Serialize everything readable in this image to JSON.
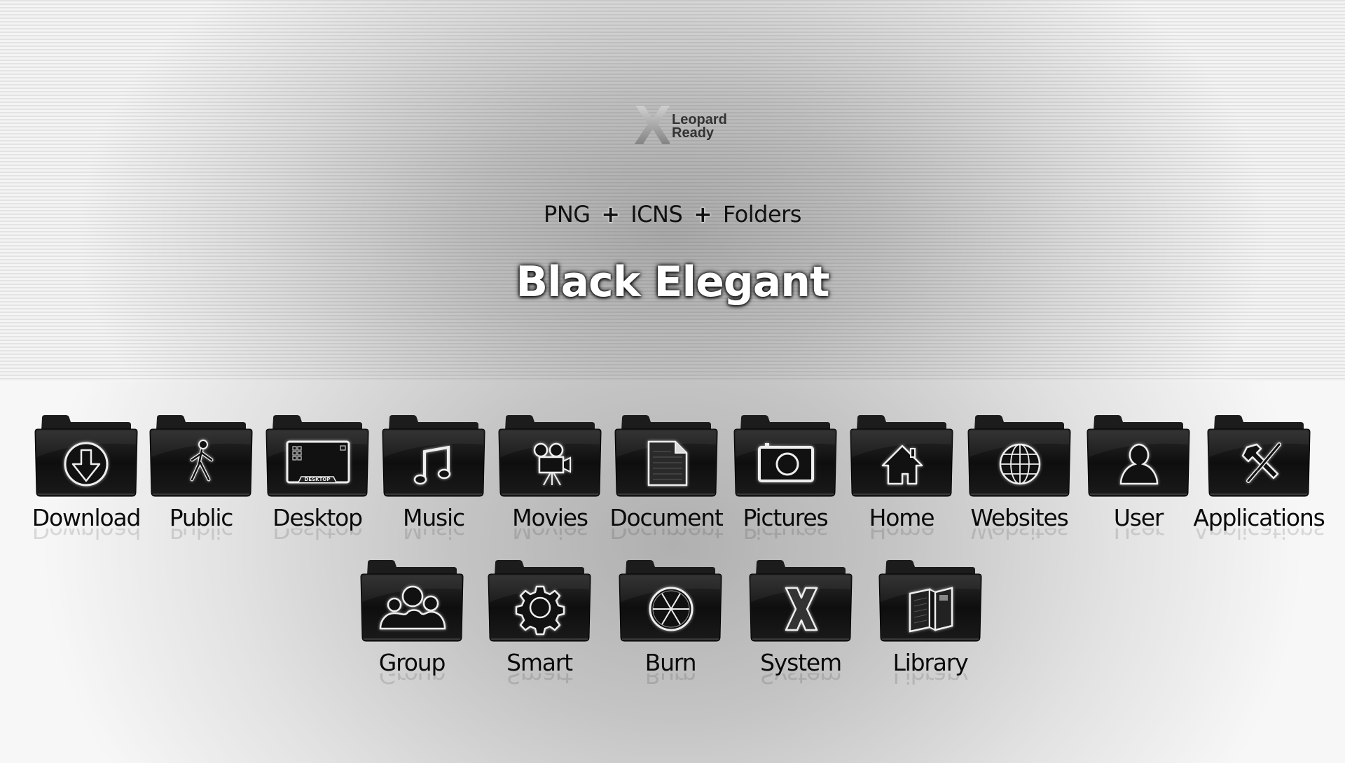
{
  "header": {
    "logo": {
      "mark": "X",
      "line1": "Leopard",
      "line2": "Ready"
    },
    "subtitle": {
      "parts": [
        "PNG",
        "ICNS",
        "Folders"
      ],
      "separator": "+"
    },
    "title": "Black Elegant"
  },
  "icons": {
    "row1": [
      {
        "label": "Download",
        "icon": "download-arrow-icon"
      },
      {
        "label": "Public",
        "icon": "walking-person-icon"
      },
      {
        "label": "Desktop",
        "icon": "desktop-screen-icon",
        "inner_text": "DESKTOP"
      },
      {
        "label": "Music",
        "icon": "music-note-icon"
      },
      {
        "label": "Movies",
        "icon": "movie-camera-icon"
      },
      {
        "label": "Document",
        "icon": "document-page-icon"
      },
      {
        "label": "Pictures",
        "icon": "camera-icon"
      },
      {
        "label": "Home",
        "icon": "house-icon"
      },
      {
        "label": "Websites",
        "icon": "globe-icon"
      },
      {
        "label": "User",
        "icon": "user-silhouette-icon"
      },
      {
        "label": "Applications",
        "icon": "hammer-screwdriver-icon"
      }
    ],
    "row2": [
      {
        "label": "Group",
        "icon": "group-people-icon"
      },
      {
        "label": "Smart",
        "icon": "gear-icon"
      },
      {
        "label": "Burn",
        "icon": "burn-disc-icon"
      },
      {
        "label": "System",
        "icon": "osx-x-icon"
      },
      {
        "label": "Library",
        "icon": "open-book-icon"
      }
    ]
  },
  "colors": {
    "folder_body": "#111111",
    "icon_stroke": "#f0f0f0",
    "label_text": "#0a0a0a",
    "title_text": "#ffffff"
  }
}
